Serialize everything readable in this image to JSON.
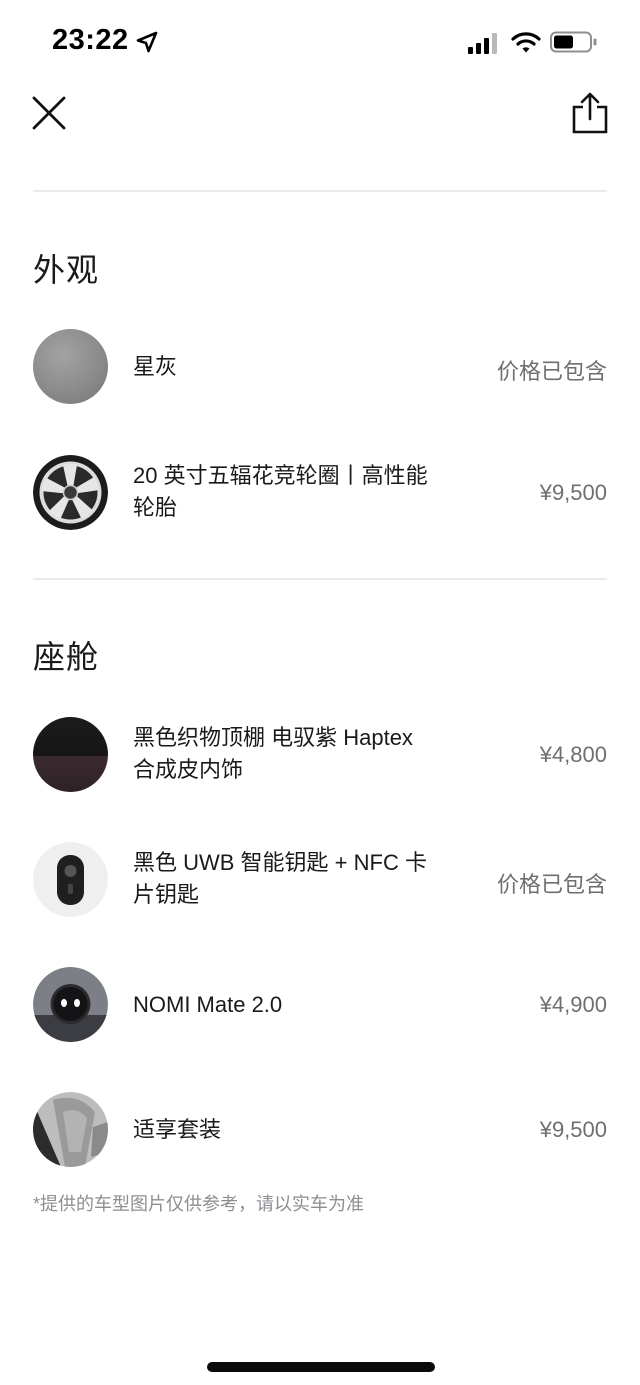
{
  "status_bar": {
    "time": "23:22"
  },
  "sections": [
    {
      "title": "外观",
      "items": [
        {
          "name": "星灰",
          "price": "价格已包含",
          "icon": "star-gray-paint-swatch"
        },
        {
          "name": "20 英寸五辐花竞轮圈丨高性能轮胎",
          "price": "¥9,500",
          "icon": "wheel-rim-thumbnail"
        }
      ]
    },
    {
      "title": "座舱",
      "items": [
        {
          "name": "黑色织物顶棚 电驭紫 Haptex合成皮内饰",
          "price": "¥4,800",
          "icon": "interior-trim-swatch"
        },
        {
          "name": "黑色 UWB 智能钥匙 + NFC 卡片钥匙",
          "price": "价格已包含",
          "icon": "smart-key-thumbnail"
        },
        {
          "name": "NOMI Mate 2.0",
          "price": "¥4,900",
          "icon": "nomi-mate-thumbnail"
        },
        {
          "name": "适享套装",
          "price": "¥9,500",
          "icon": "comfort-package-thumbnail"
        }
      ]
    }
  ],
  "disclaimer": "*提供的车型图片仅供参考，请以实车为准",
  "colors": {
    "text": "#1a1a1a",
    "secondary": "#6e6e73",
    "divider": "#e9e9e9",
    "paint_swatch": "#8a8a8a"
  }
}
